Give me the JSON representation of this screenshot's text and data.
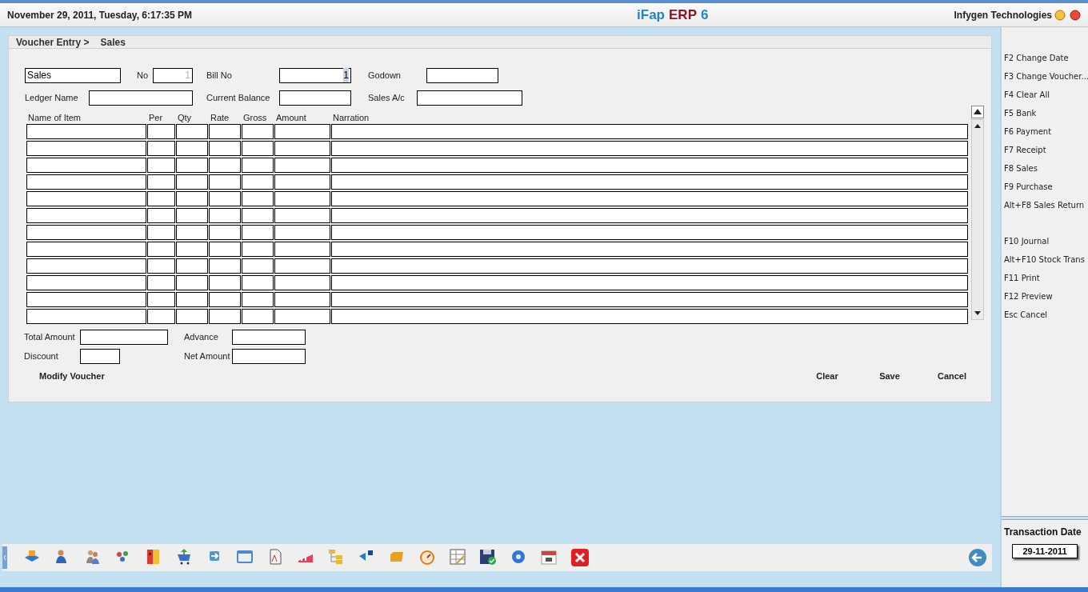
{
  "header": {
    "datetime": "November  29, 2011, Tuesday, 6:17:35 PM",
    "title_parts": [
      {
        "text": "iFap",
        "color": "#1f86c6"
      },
      {
        "text": "ERP",
        "color": "#8a1520"
      },
      {
        "text": "6",
        "color": "#1f86c6"
      }
    ],
    "company": "Infygen Technologies"
  },
  "breadcrumb": [
    "Voucher Entry >",
    "Sales"
  ],
  "form": {
    "voucher_type": {
      "value": "Sales"
    },
    "no": {
      "label": "No",
      "value": "1",
      "disabled": true
    },
    "bill_no": {
      "label": "Bill No",
      "value": "1",
      "selected": true
    },
    "godown": {
      "label": "Godown"
    },
    "ledger_name": {
      "label": "Ledger Name"
    },
    "current_balance": {
      "label": "Current Balance"
    },
    "sales_ac": {
      "label": "Sales A/c"
    }
  },
  "table": {
    "columns": [
      "Name of Item",
      "Per",
      "Qty",
      "Rate",
      "Gross",
      "Amount",
      "Narration"
    ],
    "rows": [
      {
        "kind": "entry"
      },
      {
        "kind": "entry"
      },
      {
        "kind": "entry"
      },
      {
        "kind": "entry"
      },
      {
        "kind": "entry"
      },
      {
        "kind": "entry"
      },
      {
        "kind": "entry"
      },
      {
        "kind": "entry"
      },
      {
        "kind": "entry"
      },
      {
        "kind": "entry"
      },
      {
        "kind": "entry"
      },
      {
        "kind": "entry"
      }
    ]
  },
  "totals": [
    {
      "label": "Total Amount"
    },
    {
      "label": "Advance"
    },
    {
      "label": "Discount"
    },
    {
      "label": "Net Amount"
    }
  ],
  "buttons": {
    "modify": "Modify Voucher",
    "actions": [
      "Clear",
      "Save",
      "Cancel"
    ]
  },
  "shortcuts": [
    [
      {
        "label": "F2 Change Date"
      },
      {
        "label": "F3 Change Voucher..."
      },
      {
        "label": "F4 Clear All"
      },
      {
        "label": "F5 Bank"
      },
      {
        "label": "F6 Payment"
      },
      {
        "label": "F7 Receipt"
      },
      {
        "label": "F8 Sales"
      },
      {
        "label": "F9 Purchase"
      },
      {
        "label": "Alt+F8 Sales Return"
      }
    ],
    [
      {
        "label": "F10 Journal"
      },
      {
        "label": "Alt+F10 Stock Trans"
      },
      {
        "label": "F11 Print"
      },
      {
        "label": "F12 Preview"
      },
      {
        "label": "Esc Cancel"
      }
    ]
  ],
  "transaction": {
    "label": "Transaction Date",
    "date": "29-11-2011"
  }
}
